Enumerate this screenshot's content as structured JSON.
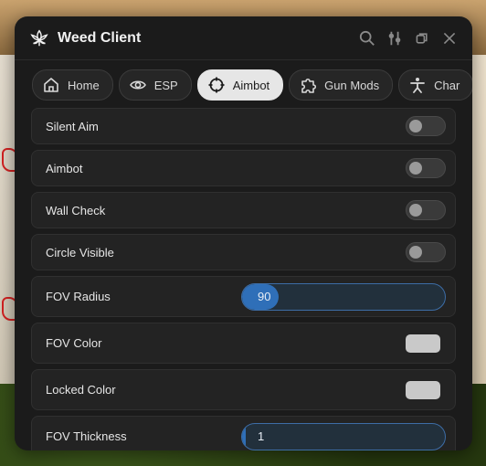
{
  "window": {
    "title": "Weed Client"
  },
  "titlebar_icons": [
    "search-icon",
    "sliders-icon",
    "restore-icon",
    "close-icon"
  ],
  "tabs": [
    {
      "label": "Home",
      "icon": "home-icon",
      "active": false
    },
    {
      "label": "ESP",
      "icon": "eye-icon",
      "active": false
    },
    {
      "label": "Aimbot",
      "icon": "crosshair-icon",
      "active": true
    },
    {
      "label": "Gun Mods",
      "icon": "puzzle-icon",
      "active": false
    },
    {
      "label": "Char",
      "icon": "person-icon",
      "active": false
    }
  ],
  "settings": {
    "silent_aim": {
      "label": "Silent Aim",
      "enabled": false
    },
    "aimbot": {
      "label": "Aimbot",
      "enabled": false
    },
    "wall_check": {
      "label": "Wall Check",
      "enabled": false
    },
    "circle_visible": {
      "label": "Circle Visible",
      "enabled": false
    },
    "fov_radius": {
      "label": "FOV Radius",
      "value": "90",
      "fill_fraction": 0.18
    },
    "fov_color": {
      "label": "FOV Color",
      "color": "#c9c9c9"
    },
    "locked_color": {
      "label": "Locked Color",
      "color": "#c9c9c9"
    },
    "fov_thickness": {
      "label": "FOV Thickness",
      "value": "1",
      "fill_fraction": 0.02
    }
  },
  "colors": {
    "window_bg": "#1b1b1b",
    "accent": "#2f6fb8",
    "tab_active": "#e6e6e6"
  }
}
